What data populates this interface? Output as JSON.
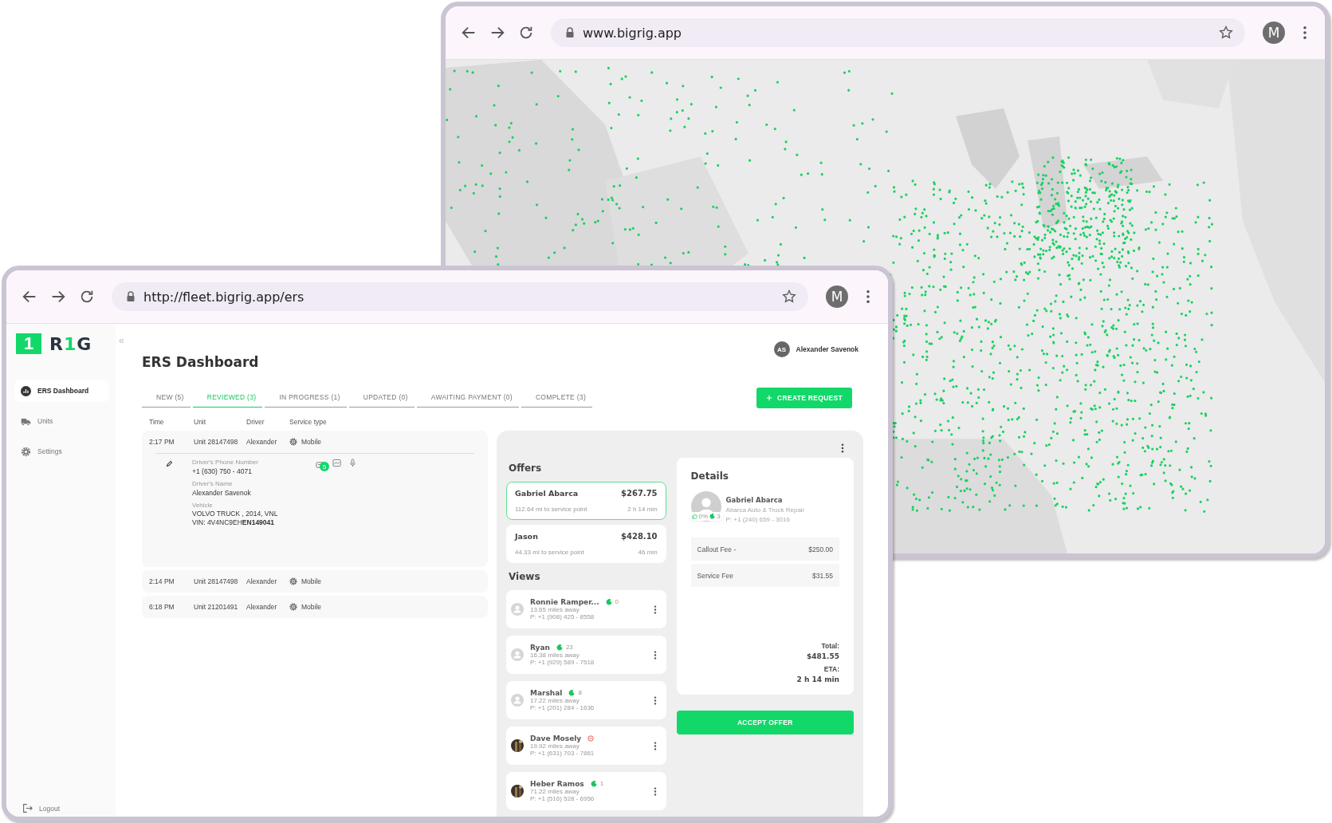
{
  "back_browser": {
    "address": "www.bigrig.app",
    "profile_initial": "M"
  },
  "front_browser": {
    "address": "http://fleet.bigrig.app/ers",
    "profile_initial": "M"
  },
  "app": {
    "logo": {
      "badge": "1",
      "word": [
        {
          "text": "R",
          "accent": false
        },
        {
          "text": "1",
          "accent": true
        },
        {
          "text": "G",
          "accent": false
        }
      ]
    },
    "collapse": "«",
    "sidebar": [
      {
        "label": "ERS Dashboard",
        "selected": true
      },
      {
        "label": "Units",
        "selected": false
      },
      {
        "label": "Settings",
        "selected": false
      }
    ],
    "logout": "Logout",
    "title": "ERS Dashboard",
    "user": {
      "initials": "AS",
      "name": "Alexander Savenok"
    },
    "tabs": [
      {
        "label": "NEW (5)",
        "selected": false
      },
      {
        "label": "REVIEWED (3)",
        "selected": true
      },
      {
        "label": "IN PROGRESS (1)",
        "selected": false
      },
      {
        "label": "UPDATED (0)",
        "selected": false
      },
      {
        "label": "AWAITING PAYMENT (0)",
        "selected": false
      },
      {
        "label": "COMPLETE (3)",
        "selected": false
      }
    ],
    "create_button": "CREATE REQUEST",
    "columns": [
      "Time",
      "Unit",
      "Driver",
      "Service type"
    ],
    "rows": [
      {
        "time": "2:17 PM",
        "unit": "Unit 28147498",
        "driver": "Alexander",
        "service": "Mobile",
        "expanded": true,
        "details": {
          "phone_label": "Driver's Phone Number",
          "phone": "+1 (630) 750 - 4071",
          "name_label": "Driver's Name",
          "name": "Alexander Savenok",
          "vehicle_label": "Vehicle",
          "vehicle": "VOLVO TRUCK , 2014, VNL",
          "vin": "VIN: 4V4NC9EH**EN149041**",
          "messages": "5"
        }
      },
      {
        "time": "2:14 PM",
        "unit": "Unit 28147498",
        "driver": "Alexander",
        "service": "Mobile",
        "expanded": false
      },
      {
        "time": "6:18 PM",
        "unit": "Unit 21201491",
        "driver": "Alexander",
        "service": "Mobile",
        "expanded": false
      }
    ],
    "offers": {
      "title": "Offers",
      "items": [
        {
          "name": "Gabriel Abarca",
          "price": "$267.75",
          "distance": "112.64 mi to service point",
          "eta": "2 h 14 min",
          "selected": true
        },
        {
          "name": "Jason",
          "price": "$428.10",
          "distance": "44.33 mi to service point",
          "eta": "46 min",
          "selected": false
        }
      ]
    },
    "views": {
      "title": "Views",
      "items": [
        {
          "name": "Ronnie Ramper...",
          "kind": "scored",
          "score": "0",
          "photo": false,
          "distance": "13.65 miles away",
          "phone": "P: +1 (908) 425 - 8558"
        },
        {
          "name": "Ryan",
          "kind": "scored",
          "score": "23",
          "photo": false,
          "distance": "16.38 miles away",
          "phone": "P: +1 (929) 589 - 7518"
        },
        {
          "name": "Marshal",
          "kind": "scored",
          "score": "8",
          "photo": false,
          "distance": "17.22 miles away",
          "phone": "P: +1 (201) 284 - 1636"
        },
        {
          "name": "Dave Mosely",
          "kind": "blocked",
          "photo": true,
          "distance": "19.92 miles away",
          "phone": "P: +1 (631) 703 - 7861"
        },
        {
          "name": "Heber Ramos",
          "kind": "scored",
          "score": "1",
          "photo": true,
          "distance": "71.22 miles away",
          "phone": "P: +1 (516) 528 - 6956"
        }
      ]
    },
    "details": {
      "title": "Details",
      "provider": {
        "name": "Gabriel Abarca",
        "company": "Abarca Auto & Truck Repair",
        "phone": "P: +1 (240) 659 - 3016",
        "rating": "0%",
        "score": "3"
      },
      "fees": [
        {
          "label": "Callout Fee -",
          "amount": "$250.00"
        },
        {
          "label": "Service Fee",
          "amount": "$31.55"
        }
      ],
      "total_label": "Total:",
      "total": "$481.55",
      "eta_label": "ETA:",
      "eta": "2 h 14 min"
    },
    "accept_button": "ACCEPT OFFER"
  }
}
